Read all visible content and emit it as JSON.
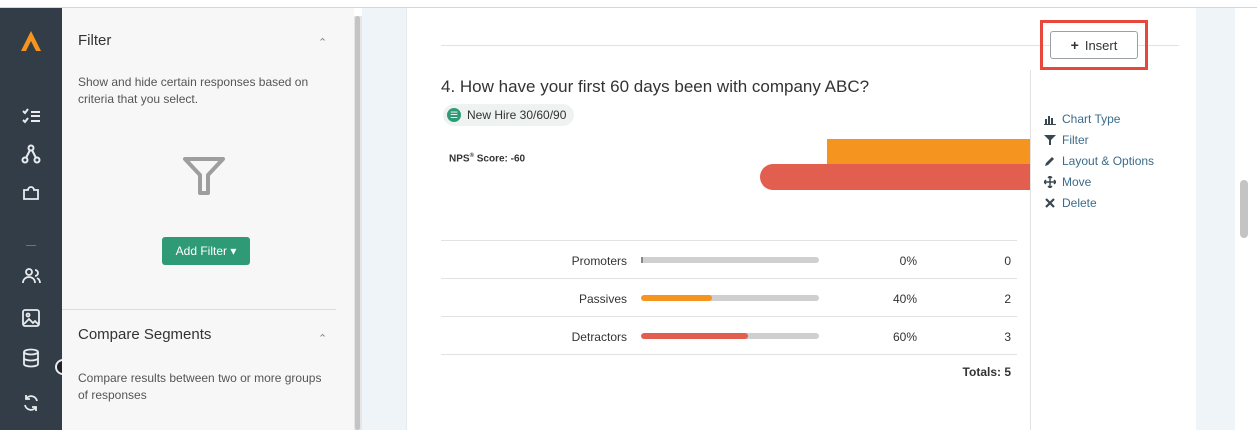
{
  "colors": {
    "rail": "#333d47",
    "accent_green": "#2e9b76",
    "orange": "#f5941e",
    "red": "#e25f4f",
    "highlight": "#e8473b"
  },
  "rail": {
    "icons": [
      "logo-icon",
      "checklist-icon",
      "share-nodes-icon",
      "puzzle-icon",
      "users-icon",
      "image-icon",
      "database-icon",
      "refresh-icon"
    ]
  },
  "sidebar": {
    "filter": {
      "title": "Filter",
      "description": "Show and hide certain responses based on criteria that you select.",
      "add_button": "Add Filter ▾"
    },
    "compare": {
      "title": "Compare Segments",
      "description": "Compare results between two or more groups of responses"
    }
  },
  "question": {
    "title": "4. How have your first 60 days been with company ABC?",
    "tag": "New Hire 30/60/90",
    "nps_label": "NPS",
    "nps_sup": "®",
    "nps_value": " Score: -60"
  },
  "nps_bars": {
    "orange_fraction": 0.4,
    "red_fraction": 0.6
  },
  "results": {
    "rows": [
      {
        "label": "Promoters",
        "percent": "0%",
        "count": "0",
        "fraction": 0.0,
        "color": "#cfcfcf"
      },
      {
        "label": "Passives",
        "percent": "40%",
        "count": "2",
        "fraction": 0.4,
        "color": "#f5941e"
      },
      {
        "label": "Detractors",
        "percent": "60%",
        "count": "3",
        "fraction": 0.6,
        "color": "#e25f4f"
      }
    ],
    "totals": "Totals: 5"
  },
  "toolbar": {
    "insert_label": "Insert",
    "actions": [
      {
        "label": "Chart Type",
        "icon": "bar-chart-icon"
      },
      {
        "label": "Filter",
        "icon": "filter-icon"
      },
      {
        "label": "Layout & Options",
        "icon": "pencil-icon"
      },
      {
        "label": "Move",
        "icon": "move-arrows-icon"
      },
      {
        "label": "Delete",
        "icon": "close-icon"
      }
    ]
  }
}
